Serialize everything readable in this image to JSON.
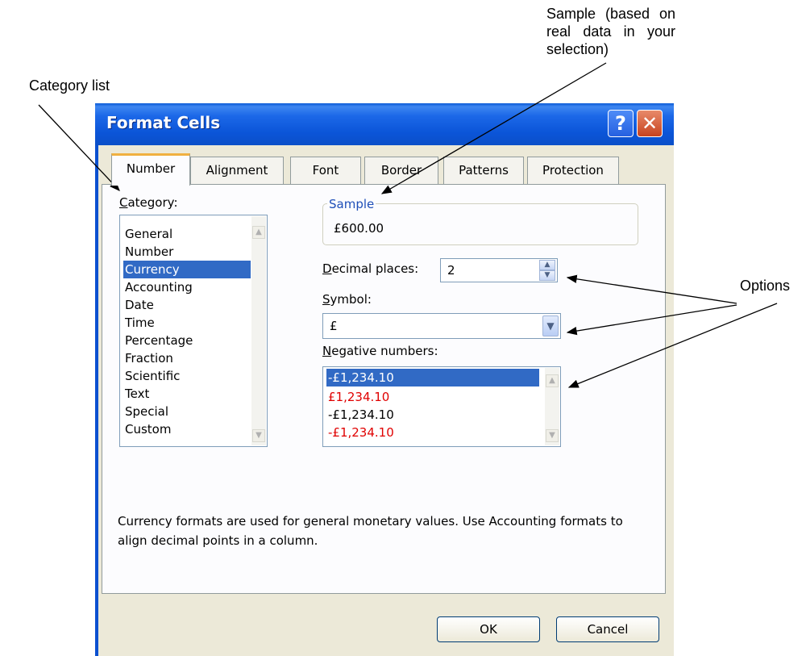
{
  "annotations": {
    "sample": "Sample (based on real data in your selection)",
    "category": "Category list",
    "options": "Options"
  },
  "dialog": {
    "title": "Format Cells",
    "help_label": "?",
    "close_label": "✕",
    "tabs": [
      "Number",
      "Alignment",
      "Font",
      "Border",
      "Patterns",
      "Protection"
    ],
    "active_tab": "Number",
    "category": {
      "label_prefix": "C",
      "label_rest": "ategory:",
      "items": [
        "General",
        "Number",
        "Currency",
        "Accounting",
        "Date",
        "Time",
        "Percentage",
        "Fraction",
        "Scientific",
        "Text",
        "Special",
        "Custom"
      ],
      "selected": "Currency"
    },
    "sample": {
      "legend": "Sample",
      "value": "£600.00"
    },
    "decimal": {
      "label_prefix": "D",
      "label_rest": "ecimal places:",
      "value": "2"
    },
    "symbol": {
      "label_prefix": "S",
      "label_rest": "ymbol:",
      "value": "£"
    },
    "negative": {
      "label_prefix": "N",
      "label_rest": "egative numbers:",
      "items": [
        {
          "text": "-£1,234.10",
          "color": "#ffffff",
          "selected": true
        },
        {
          "text": "£1,234.10",
          "color": "#e00000",
          "selected": false
        },
        {
          "text": "-£1,234.10",
          "color": "#000000",
          "selected": false
        },
        {
          "text": "-£1,234.10",
          "color": "#e00000",
          "selected": false
        }
      ]
    },
    "description": "Currency formats are used for general monetary values.  Use Accounting formats to align decimal points in a column.",
    "ok_label": "OK",
    "cancel_label": "Cancel"
  }
}
